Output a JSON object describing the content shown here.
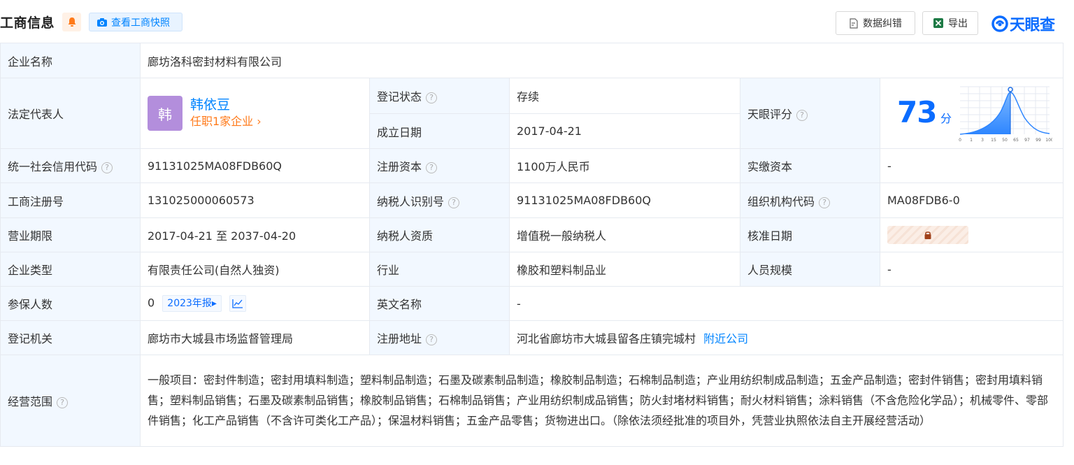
{
  "header": {
    "title": "工商信息",
    "snapshot_label": "查看工商快照",
    "correct_label": "数据纠错",
    "export_label": "导出",
    "brand": "天眼查"
  },
  "fields": {
    "company_name_label": "企业名称",
    "company_name": "廊坊洛科密封材料有限公司",
    "legal_rep_label": "法定代表人",
    "legal_rep_avatar": "韩",
    "legal_rep_name": "韩依豆",
    "legal_rep_sub": "任职1家企业",
    "reg_status_label": "登记状态",
    "reg_status": "存续",
    "found_date_label": "成立日期",
    "found_date": "2017-04-21",
    "score_label": "天眼评分",
    "score": "73",
    "score_unit": "分",
    "credit_code_label": "统一社会信用代码",
    "credit_code": "91131025MA08FDB60Q",
    "reg_capital_label": "注册资本",
    "reg_capital": "1100万人民币",
    "paid_capital_label": "实缴资本",
    "paid_capital": "-",
    "biz_reg_no_label": "工商注册号",
    "biz_reg_no": "131025000060573",
    "taxpayer_id_label": "纳税人识别号",
    "taxpayer_id": "91131025MA08FDB60Q",
    "org_code_label": "组织机构代码",
    "org_code": "MA08FDB6-0",
    "term_label": "营业期限",
    "term": "2017-04-21 至 2037-04-20",
    "taxpayer_qual_label": "纳税人资质",
    "taxpayer_qual": "增值税一般纳税人",
    "approve_date_label": "核准日期",
    "company_type_label": "企业类型",
    "company_type": "有限责任公司(自然人独资)",
    "industry_label": "行业",
    "industry": "橡胶和塑料制品业",
    "staff_size_label": "人员规模",
    "staff_size": "-",
    "insured_label": "参保人数",
    "insured": "0",
    "insured_report": "2023年报",
    "english_name_label": "英文名称",
    "english_name": "-",
    "authority_label": "登记机关",
    "authority": "廊坊市大城县市场监督管理局",
    "address_label": "注册地址",
    "address": "河北省廊坊市大城县留各庄镇完城村",
    "nearby_label": "附近公司",
    "scope_label": "经营范围",
    "scope": "一般项目：密封件制造；密封用填料制造；塑料制品制造；石墨及碳素制品制造；橡胶制品制造；石棉制品制造；产业用纺织制成品制造；五金产品制造；密封件销售；密封用填料销售；塑料制品销售；石墨及碳素制品销售；橡胶制品销售；石棉制品销售；产业用纺织制成品销售；防火封堵材料销售；耐火材料销售；涂料销售（不含危险化学品）；机械零件、零部件销售；化工产品销售（不含许可类化工产品）；保温材料销售；五金产品零售；货物进出口。（除依法须经批准的项目外，凭营业执照依法自主开展经营活动）"
  },
  "score_chart": {
    "ticks": [
      "0",
      "1",
      "3",
      "15",
      "50",
      "65",
      "97",
      "99",
      "100"
    ]
  },
  "colors": {
    "accent": "#0084ff",
    "brand": "#0a6cff",
    "status_green": "#1aaa55",
    "label_bg": "#f2f8ff",
    "orange": "#ff7a1a"
  }
}
